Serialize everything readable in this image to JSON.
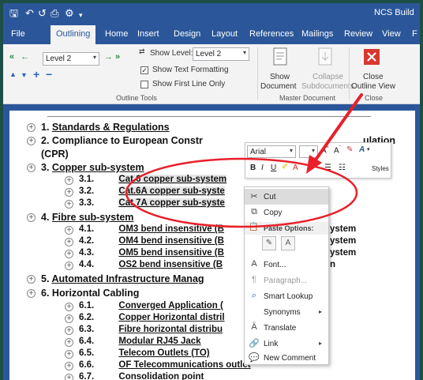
{
  "title_bar": {
    "app_title": "NCS Build",
    "qat": {
      "save": "🖫",
      "undo": "↶",
      "redo": "↺",
      "print_preview": "⎙",
      "customize": "▾"
    }
  },
  "tabs": [
    "File",
    "Outlining",
    "Home",
    "Insert",
    "Design",
    "Layout",
    "References",
    "Mailings",
    "Review",
    "View",
    "F"
  ],
  "ribbon": {
    "outline_tools": {
      "level_value": "Level 2",
      "show_level_label": "Show Level:",
      "show_level_value": "Level 2",
      "show_text_formatting": "Show Text Formatting",
      "show_text_formatting_checked": true,
      "show_first_line_only": "Show First Line Only",
      "show_first_line_only_checked": false,
      "group_label": "Outline Tools"
    },
    "master_document": {
      "show_document_line1": "Show",
      "show_document_line2": "Document",
      "collapse_line1": "Collapse",
      "collapse_line2": "Subdocuments",
      "group_label": "Master Document"
    },
    "close": {
      "close_line1": "Close",
      "close_line2": "Outline View",
      "group_label": "Close"
    }
  },
  "document": {
    "headings": [
      {
        "num": "1.",
        "text": "Standards & Regulations"
      },
      {
        "num": "2.",
        "text": "Compliance to European Constr",
        "tail": "ulation"
      },
      {
        "num": "",
        "text": "(CPR)"
      },
      {
        "num": "3.",
        "text": "Copper sub-system"
      },
      {
        "num": "4.",
        "text": "Fibre sub-system"
      },
      {
        "num": "5.",
        "text": "Automated Infrastructure Manag"
      },
      {
        "num": "6.",
        "text": "Horizontal Cabling"
      }
    ],
    "copper_items": [
      {
        "num": "3.1.",
        "text": "Cat.6 copper sub-system"
      },
      {
        "num": "3.2.",
        "text": "Cat.6A copper sub-syste"
      },
      {
        "num": "3.3.",
        "text": "Cat.7A copper sub-syste"
      }
    ],
    "fibre_items": [
      {
        "num": "4.1.",
        "text": "OM3 bend insensitive (B",
        "tail": "ystem"
      },
      {
        "num": "4.2.",
        "text": "OM4 bend insensitive (B",
        "tail": "ystem"
      },
      {
        "num": "4.3.",
        "text": "OM5 bend insensitive (B",
        "tail": "ystem"
      },
      {
        "num": "4.4.",
        "text": "OS2 bend insensitive (B",
        "tail": "n"
      }
    ],
    "horizontal_items": [
      {
        "num": "6.1.",
        "text": "Converged Application ("
      },
      {
        "num": "6.2.",
        "text": "Copper Horizontal distril"
      },
      {
        "num": "6.3.",
        "text": "Fibre horizontal distribu"
      },
      {
        "num": "6.4.",
        "text": "Modular RJ45 Jack"
      },
      {
        "num": "6.5.",
        "text": "Telecom Outlets (TO)"
      },
      {
        "num": "6.6.",
        "text": "OF Telecommunications outlet"
      },
      {
        "num": "6.7.",
        "text": "Consolidation point"
      }
    ]
  },
  "mini_toolbar": {
    "font": "Arial",
    "styles": "Styles"
  },
  "context_menu": {
    "cut": "Cut",
    "copy": "Copy",
    "paste_options": "Paste Options:",
    "font": "Font...",
    "paragraph": "Paragraph...",
    "smart_lookup": "Smart Lookup",
    "synonyms": "Synonyms",
    "translate": "Translate",
    "link": "Link",
    "new_comment": "New Comment"
  },
  "colors": {
    "ribbon_blue": "#2b579a",
    "annotation_red": "#e8202a",
    "outer_frame": "#1e4f46"
  }
}
